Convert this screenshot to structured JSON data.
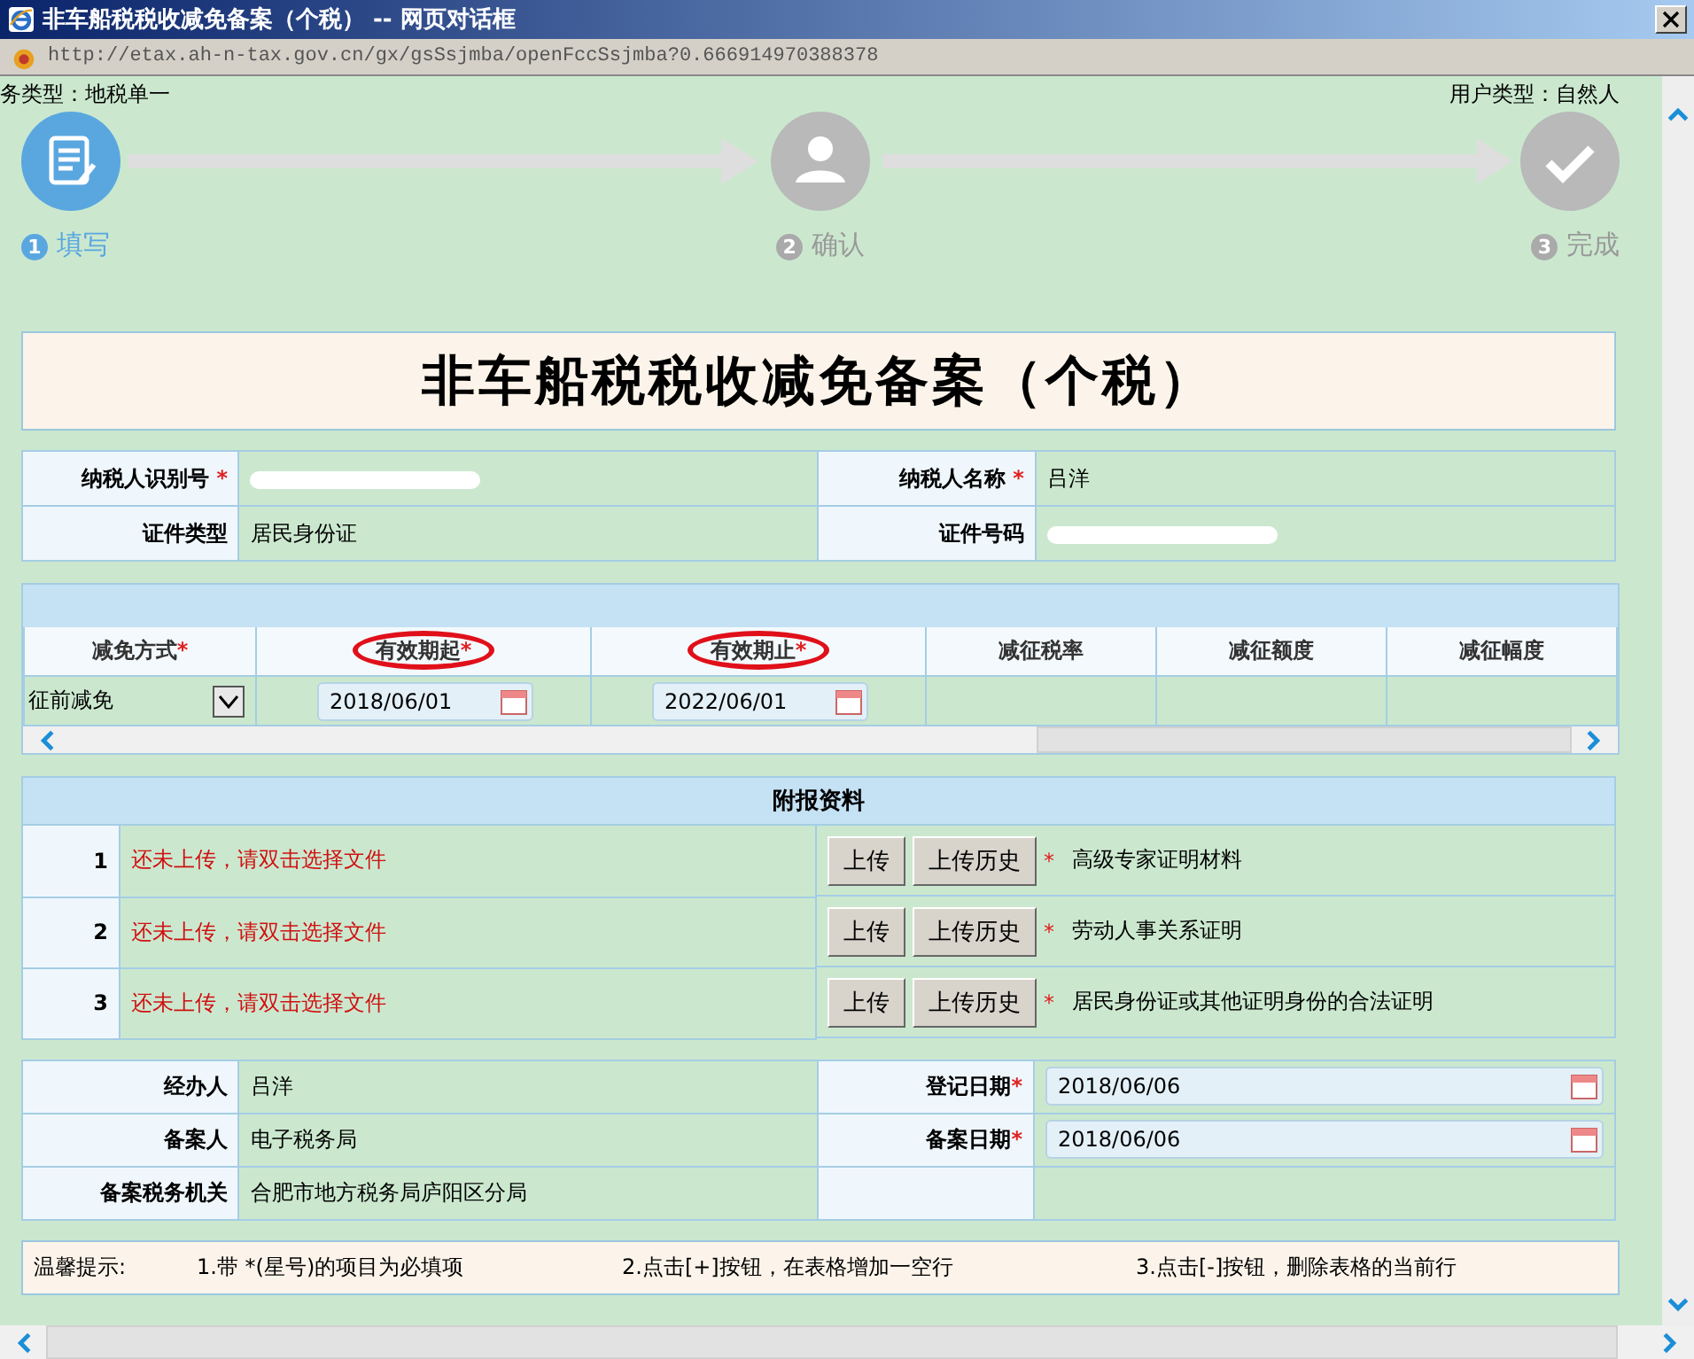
{
  "window": {
    "title": "非车船税税收减免备案（个税） -- 网页对话框",
    "address": "http://etax.ah-n-tax.gov.cn/gx/gsSsjmba/openFccSsjmba?0.666914970388378"
  },
  "header": {
    "left": "务类型：地税单一",
    "right": "用户类型：自然人"
  },
  "steps": [
    {
      "number": "1",
      "label": "填写",
      "active": true,
      "kind": "form"
    },
    {
      "number": "2",
      "label": "确认",
      "active": false,
      "kind": "person"
    },
    {
      "number": "3",
      "label": "完成",
      "active": false,
      "kind": "check"
    }
  ],
  "form_title": "非车船税税收减免备案（个税）",
  "taxpayer": [
    [
      {
        "label": "纳税人识别号",
        "mark": "*",
        "redacted": true
      },
      {
        "label": "纳税人名称",
        "mark": "*",
        "value": "吕洋"
      }
    ],
    [
      {
        "label": "证件类型",
        "value": "居民身份证"
      },
      {
        "label": "证件号码",
        "redacted": true
      }
    ]
  ],
  "relief_table": {
    "columns": [
      {
        "label": "减免方式",
        "mark": "*",
        "circled": false
      },
      {
        "label": "有效期起",
        "mark": "*",
        "circled": true
      },
      {
        "label": "有效期止",
        "mark": "*",
        "circled": true
      },
      {
        "label": "减征税率",
        "circled": false
      },
      {
        "label": "减征额度",
        "circled": false
      },
      {
        "label": "减征幅度",
        "circled": false
      }
    ],
    "row": {
      "method": "征前减免",
      "start": "2018/06/01",
      "end": "2022/06/01"
    }
  },
  "attachments": {
    "title": "附报资料",
    "rows": [
      {
        "number": "1",
        "status": "还未上传，请双击选择文件",
        "upload": "上传",
        "history": "上传历史",
        "mark": "*",
        "name": "高级专家证明材料"
      },
      {
        "number": "2",
        "status": "还未上传，请双击选择文件",
        "upload": "上传",
        "history": "上传历史",
        "mark": "*",
        "name": "劳动人事关系证明"
      },
      {
        "number": "3",
        "status": "还未上传，请双击选择文件",
        "upload": "上传",
        "history": "上传历史",
        "mark": "*",
        "name": "居民身份证或其他证明身份的合法证明"
      }
    ]
  },
  "filing": [
    [
      {
        "label": "经办人",
        "kind": "text",
        "value": "吕洋"
      },
      {
        "label": "登记日期",
        "mark": "*",
        "kind": "date",
        "value": "2018/06/06"
      }
    ],
    [
      {
        "label": "备案人",
        "kind": "text",
        "value": "电子税务局"
      },
      {
        "label": "备案日期",
        "mark": "*",
        "kind": "date",
        "value": "2018/06/06"
      }
    ],
    [
      {
        "label": "备案税务机关",
        "kind": "text",
        "value": "合肥市地方税务局庐阳区分局"
      },
      {
        "kind": "empty"
      }
    ]
  ],
  "tips": {
    "title": "温馨提示:",
    "items": [
      "1.带 *(星号)的项目为必填项",
      "2.点击[+]按钮，在表格增加一空行",
      "3.点击[-]按钮，删除表格的当前行"
    ]
  }
}
